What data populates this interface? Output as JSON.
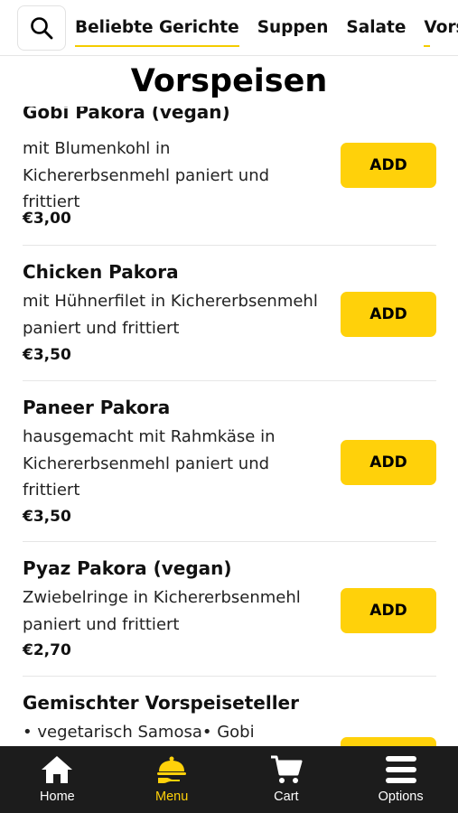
{
  "header": {
    "tabs": [
      {
        "label": "Beliebte Gerichte"
      },
      {
        "label": "Suppen"
      },
      {
        "label": "Salate"
      },
      {
        "label": "Vorsp"
      }
    ],
    "active_tab": "Beliebte Gerichte",
    "search_icon": "search-icon"
  },
  "section": {
    "title": "Vorspeisen"
  },
  "items": [
    {
      "name": "Gobi Pakora (vegan)",
      "desc": [
        "mit Blumenkohl in",
        "Kichererbsenmehl paniert und",
        "frittiert"
      ],
      "price": "€3,00",
      "button": "ADD"
    },
    {
      "name": "Chicken Pakora",
      "desc": [
        "mit Hühnerfilet in Kichererbsenmehl",
        "paniert und frittiert"
      ],
      "price": "€3,50",
      "button": "ADD"
    },
    {
      "name": "Paneer Pakora",
      "desc": [
        "hausgemacht mit Rahmkäse in",
        "Kichererbsenmehl paniert und",
        "frittiert"
      ],
      "price": "€3,50",
      "button": "ADD"
    },
    {
      "name": "Pyaz Pakora (vegan)",
      "desc": [
        "Zwiebelringe in Kichererbsenmehl",
        "paniert und frittiert"
      ],
      "price": "€2,70",
      "button": "ADD"
    },
    {
      "name": "Gemischter Vorspeiseteller",
      "desc": [
        "• vegetarisch Samosa• Gobi"
      ],
      "price": "",
      "button": ""
    }
  ],
  "nav": [
    {
      "label": "Home",
      "icon": "home-icon"
    },
    {
      "label": "Menu",
      "icon": "menu-cloche-icon"
    },
    {
      "label": "Cart",
      "icon": "cart-icon"
    },
    {
      "label": "Options",
      "icon": "hamburger-icon"
    }
  ],
  "colors": {
    "accent": "#ffd10a",
    "nav_bg": "#1c1c1c"
  }
}
